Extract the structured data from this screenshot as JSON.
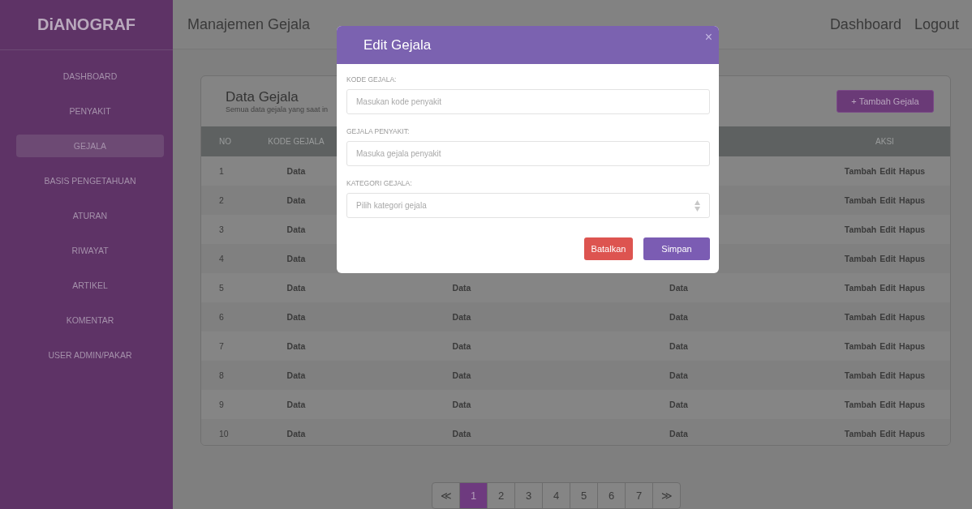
{
  "sidebar": {
    "logo": "DiANOGRAF",
    "items": [
      {
        "label": "DASHBOARD",
        "selected": false
      },
      {
        "label": "PENYAKIT",
        "selected": false
      },
      {
        "label": "GEJALA",
        "selected": true
      },
      {
        "label": "BASIS PENGETAHUAN",
        "selected": false
      },
      {
        "label": "ATURAN",
        "selected": false
      },
      {
        "label": "RIWAYAT",
        "selected": false
      },
      {
        "label": "ARTIKEL",
        "selected": false
      },
      {
        "label": "KOMENTAR",
        "selected": false
      },
      {
        "label": "USER ADMIN/PAKAR",
        "selected": false
      }
    ]
  },
  "topbar": {
    "title": "Manajemen Gejala",
    "links": [
      "Dashboard",
      "Logout"
    ]
  },
  "card": {
    "title": "Data Gejala",
    "subtitle": "Semua data gejala yang saat in",
    "add_button": "+ Tambah Gejala"
  },
  "table": {
    "columns": {
      "no": "NO",
      "kode_gejala": "KODE GEJALA",
      "aksi": "AKSI"
    },
    "rows": [
      {
        "no": "1",
        "kode_gejala": "Data",
        "actions": [
          "Tambah",
          "Edit",
          "Hapus"
        ]
      },
      {
        "no": "2",
        "kode_gejala": "Data",
        "actions": [
          "Tambah",
          "Edit",
          "Hapus"
        ]
      },
      {
        "no": "3",
        "kode_gejala": "Data",
        "actions": [
          "Tambah",
          "Edit",
          "Hapus"
        ]
      },
      {
        "no": "4",
        "kode_gejala": "Data",
        "actions": [
          "Tambah",
          "Edit",
          "Hapus"
        ]
      },
      {
        "no": "5",
        "kode_gejala": "Data",
        "column_3": "Data",
        "column_4": "Data",
        "actions": [
          "Tambah",
          "Edit",
          "Hapus"
        ]
      },
      {
        "no": "6",
        "kode_gejala": "Data",
        "column_3": "Data",
        "column_4": "Data",
        "actions": [
          "Tambah",
          "Edit",
          "Hapus"
        ]
      },
      {
        "no": "7",
        "kode_gejala": "Data",
        "column_3": "Data",
        "column_4": "Data",
        "actions": [
          "Tambah",
          "Edit",
          "Hapus"
        ]
      },
      {
        "no": "8",
        "kode_gejala": "Data",
        "column_3": "Data",
        "column_4": "Data",
        "actions": [
          "Tambah",
          "Edit",
          "Hapus"
        ]
      },
      {
        "no": "9",
        "kode_gejala": "Data",
        "column_3": "Data",
        "column_4": "Data",
        "actions": [
          "Tambah",
          "Edit",
          "Hapus"
        ]
      },
      {
        "no": "10",
        "kode_gejala": "Data",
        "column_3": "Data",
        "column_4": "Data",
        "actions": [
          "Tambah",
          "Edit",
          "Hapus"
        ]
      }
    ]
  },
  "pagination": {
    "prev": "≪",
    "pages": [
      {
        "label": "1",
        "selected": true
      },
      {
        "label": "2",
        "selected": false
      },
      {
        "label": "3",
        "selected": false
      },
      {
        "label": "4",
        "selected": false
      },
      {
        "label": "5",
        "selected": false
      },
      {
        "label": "6",
        "selected": false
      },
      {
        "label": "7",
        "selected": false
      }
    ],
    "next": "≫"
  },
  "modal": {
    "title": "Edit Gejala",
    "close": "×",
    "fields": [
      {
        "kind": "text",
        "label": "KODE GEJALA:",
        "placeholder": "Masukan kode penyakit"
      },
      {
        "kind": "text",
        "label": "GEJALA PENYAKIT:",
        "placeholder": "Masuka gejala penyakit"
      },
      {
        "kind": "select",
        "label": "KATEGORI GEJALA:",
        "placeholder": "Pilih kategori gejala"
      }
    ],
    "buttons": [
      {
        "kind": "cancel",
        "label": "Batalkan"
      },
      {
        "kind": "save",
        "label": "Simpan"
      }
    ]
  }
}
